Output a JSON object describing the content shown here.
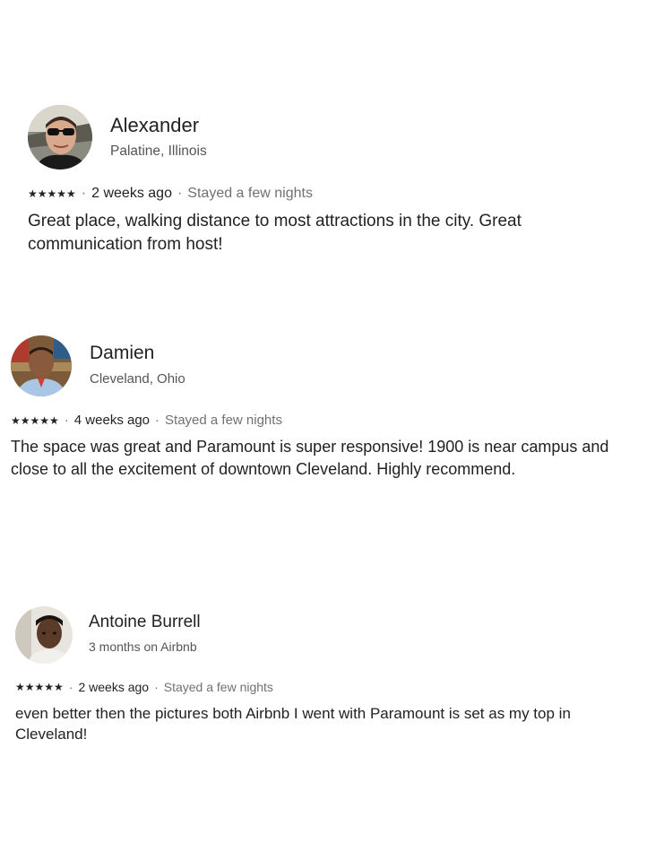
{
  "reviews": [
    {
      "name": "Alexander",
      "subline": "Palatine, Illinois",
      "rating": 5,
      "stars": "★★★★★",
      "separator": "·",
      "when": "2 weeks ago",
      "stay": "Stayed a few nights",
      "text": "Great place, walking distance to most attractions in the city. Great communication from host!"
    },
    {
      "name": "Damien",
      "subline": "Cleveland, Ohio",
      "rating": 5,
      "stars": "★★★★★",
      "separator": "·",
      "when": "4 weeks ago",
      "stay": "Stayed a few nights",
      "text": "The space was great and Paramount is super responsive! 1900 is near campus and close to all the excitement of downtown Cleveland. Highly recommend."
    },
    {
      "name": "Antoine Burrell",
      "subline": "3 months on Airbnb",
      "rating": 5,
      "stars": "★★★★★",
      "separator": "·",
      "when": "2 weeks ago",
      "stay": "Stayed a few nights",
      "text": "even better then the pictures both Airbnb I went with Paramount is set as my top in Cleveland!"
    }
  ]
}
